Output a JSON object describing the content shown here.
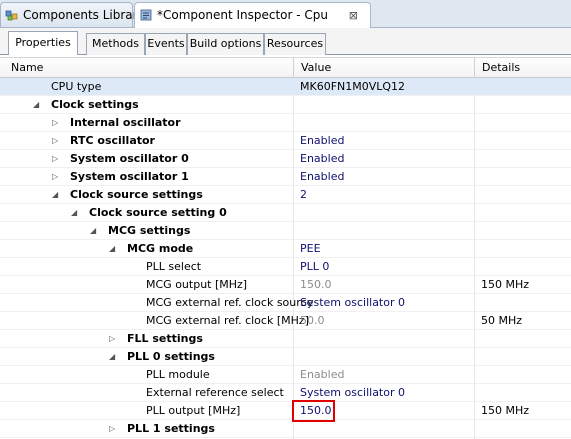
{
  "editor_tabs": {
    "library": "Components Library",
    "inspector": "*Component Inspector - Cpu",
    "close_glyph": "⊠"
  },
  "page_tabs": [
    "Properties",
    "Methods",
    "Events",
    "Build options",
    "Resources"
  ],
  "columns": {
    "name": "Name",
    "value": "Value",
    "details": "Details"
  },
  "rows": [
    {
      "name": "CPU type",
      "value": "MK60FN1M0VLQ12",
      "details": "",
      "bold": false,
      "expander": "none",
      "value_style": "black"
    },
    {
      "name": "Clock settings",
      "value": "",
      "details": "",
      "bold": true,
      "expander": "expanded",
      "value_style": "black"
    },
    {
      "name": "Internal oscillator",
      "value": "",
      "details": "",
      "bold": true,
      "expander": "collapsed",
      "value_style": "black"
    },
    {
      "name": "RTC oscillator",
      "value": "Enabled",
      "details": "",
      "bold": true,
      "expander": "collapsed",
      "value_style": "blue"
    },
    {
      "name": "System oscillator 0",
      "value": "Enabled",
      "details": "",
      "bold": true,
      "expander": "collapsed",
      "value_style": "blue"
    },
    {
      "name": "System oscillator 1",
      "value": "Enabled",
      "details": "",
      "bold": true,
      "expander": "collapsed",
      "value_style": "blue"
    },
    {
      "name": "Clock source settings",
      "value": "2",
      "details": "",
      "bold": true,
      "expander": "expanded",
      "value_style": "blue"
    },
    {
      "name": "Clock source setting 0",
      "value": "",
      "details": "",
      "bold": true,
      "expander": "expanded",
      "value_style": "black"
    },
    {
      "name": "MCG settings",
      "value": "",
      "details": "",
      "bold": true,
      "expander": "expanded",
      "value_style": "black"
    },
    {
      "name": "MCG mode",
      "value": "PEE",
      "details": "",
      "bold": true,
      "expander": "expanded",
      "value_style": "blue"
    },
    {
      "name": "PLL select",
      "value": "PLL 0",
      "details": "",
      "bold": false,
      "expander": "none",
      "value_style": "blue"
    },
    {
      "name": "MCG output [MHz]",
      "value": "150.0",
      "details": "150 MHz",
      "bold": false,
      "expander": "none",
      "value_style": "gray"
    },
    {
      "name": "MCG external ref. clock source",
      "value": "System oscillator 0",
      "details": "",
      "bold": false,
      "expander": "none",
      "value_style": "blue"
    },
    {
      "name": "MCG external ref. clock [MHz]",
      "value": "50.0",
      "details": "50 MHz",
      "bold": false,
      "expander": "none",
      "value_style": "gray"
    },
    {
      "name": "FLL settings",
      "value": "",
      "details": "",
      "bold": true,
      "expander": "collapsed",
      "value_style": "black"
    },
    {
      "name": "PLL 0 settings",
      "value": "",
      "details": "",
      "bold": true,
      "expander": "expanded",
      "value_style": "black"
    },
    {
      "name": "PLL module",
      "value": "Enabled",
      "details": "",
      "bold": false,
      "expander": "none",
      "value_style": "gray"
    },
    {
      "name": "External reference select",
      "value": "System oscillator 0",
      "details": "",
      "bold": false,
      "expander": "none",
      "value_style": "blue"
    },
    {
      "name": "PLL output [MHz]",
      "value": "150.0",
      "details": "150 MHz",
      "bold": false,
      "expander": "none",
      "value_style": "blue"
    },
    {
      "name": "PLL 1 settings",
      "value": "",
      "details": "",
      "bold": true,
      "expander": "collapsed",
      "value_style": "black"
    }
  ]
}
